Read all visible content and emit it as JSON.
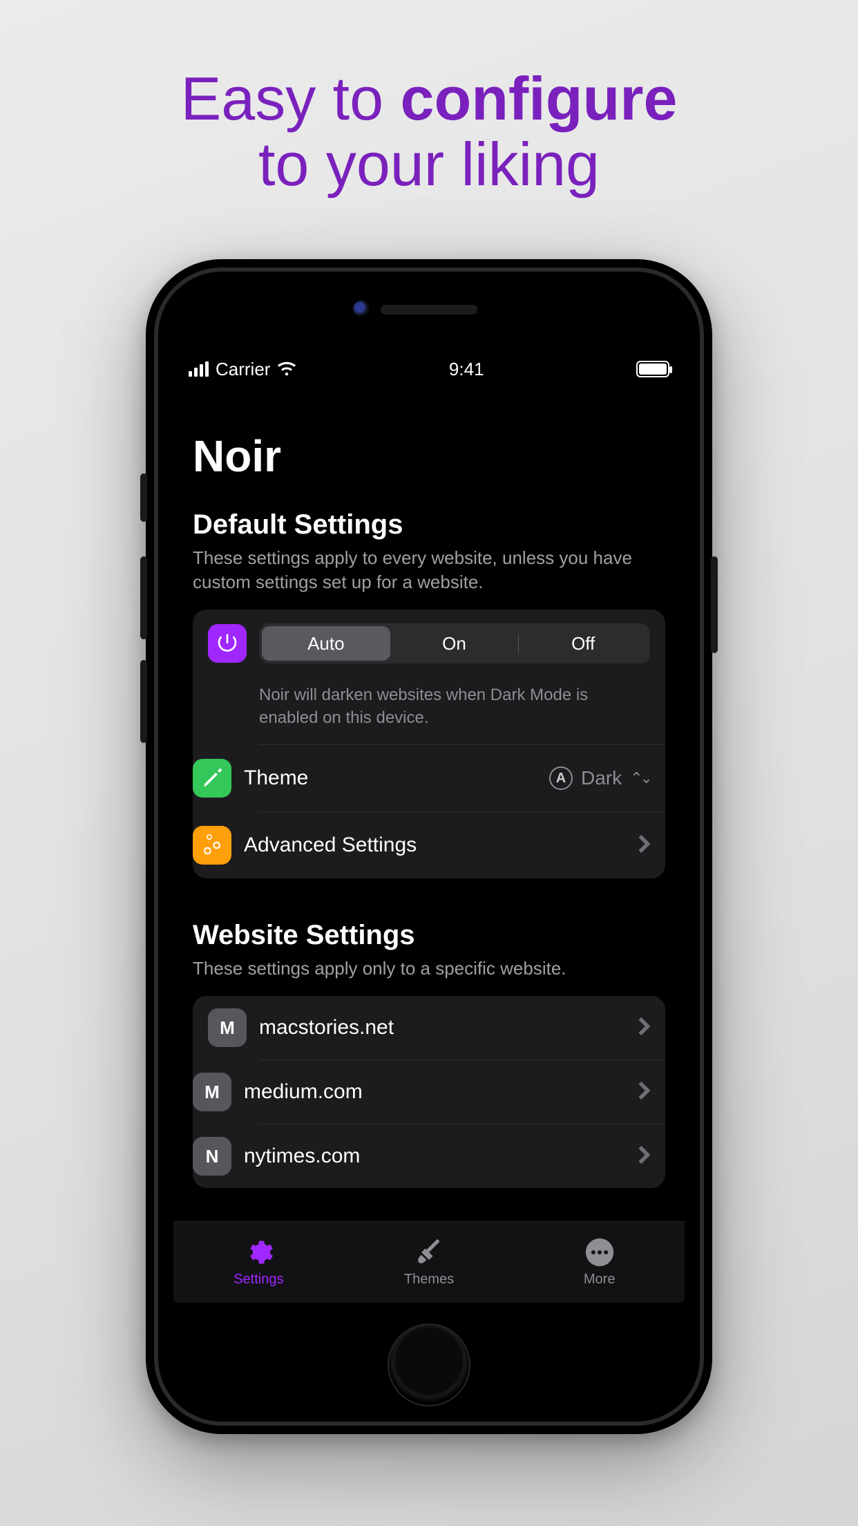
{
  "marketing": {
    "line1_prefix": "Easy to ",
    "line1_bold": "configure",
    "line2": "to your liking"
  },
  "status": {
    "carrier": "Carrier",
    "time": "9:41"
  },
  "app_title": "Noir",
  "default_section": {
    "title": "Default Settings",
    "desc": "These settings apply to every website, unless you have custom settings set up for a website.",
    "segments": {
      "auto": "Auto",
      "on": "On",
      "off": "Off",
      "selected": "Auto"
    },
    "mode_desc": "Noir will darken websites when Dark Mode is enabled on this device.",
    "theme_label": "Theme",
    "theme_value": "Dark",
    "theme_badge": "A",
    "advanced_label": "Advanced Settings"
  },
  "website_section": {
    "title": "Website Settings",
    "desc": "These settings apply only to a specific website.",
    "sites": [
      {
        "letter": "M",
        "domain": "macstories.net"
      },
      {
        "letter": "M",
        "domain": "medium.com"
      },
      {
        "letter": "N",
        "domain": "nytimes.com"
      }
    ]
  },
  "tabs": {
    "settings": "Settings",
    "themes": "Themes",
    "more": "More",
    "active": "Settings"
  }
}
